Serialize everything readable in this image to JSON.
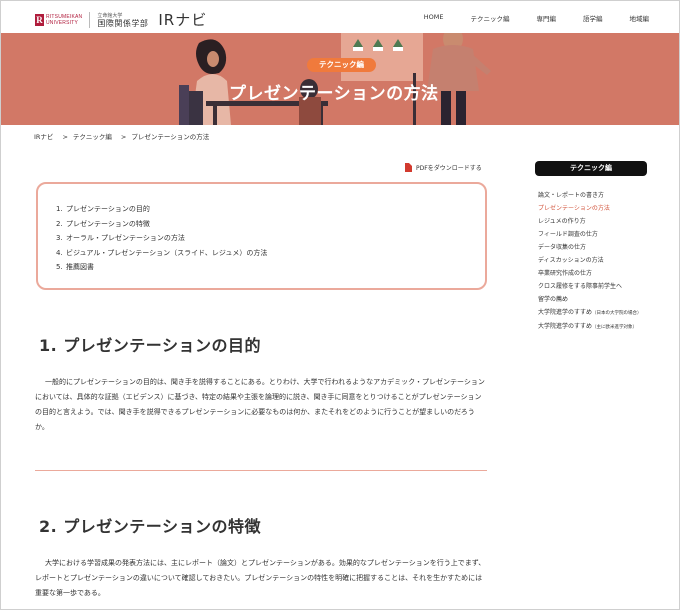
{
  "header": {
    "brand_en_line1": "RITSUMEIKAN",
    "brand_en_line2": "UNIVERSITY",
    "university": "立命館大学",
    "faculty": "国際関係学部",
    "site_name": "IRナビ",
    "nav": [
      "HOME",
      "テクニック編",
      "専門編",
      "語学編",
      "地域編"
    ]
  },
  "hero": {
    "badge": "テクニック編",
    "title": "プレゼンテーションの方法"
  },
  "breadcrumb": [
    "IRナビ",
    "テクニック編",
    "プレゼンテーションの方法"
  ],
  "pdf_link": "PDFをダウンロードする",
  "toc": [
    {
      "num": "1.",
      "label": "プレゼンテーションの目的"
    },
    {
      "num": "2.",
      "label": "プレゼンテーションの特徴"
    },
    {
      "num": "3.",
      "label": "オーラル・プレゼンテーションの方法"
    },
    {
      "num": "4.",
      "label": "ビジュアル・プレゼンテーション（スライド、レジュメ）の方法"
    },
    {
      "num": "5.",
      "label": "推薦図書"
    }
  ],
  "sections": [
    {
      "heading": "1. プレゼンテーションの目的",
      "body": "一般的にプレゼンテーションの目的は、聞き手を説得することにある。とりわけ、大学で行われるようなアカデミック・プレゼンテーションにおいては、具体的な証拠（エビデンス）に基づき、特定の結果や主張を論理的に説き、聞き手に同意をとりつけることがプレゼンテーションの目的と言えよう。では、聞き手を説得できるプレゼンテーションに必要なものは何か、またそれをどのように行うことが望ましいのだろうか。"
    },
    {
      "heading": "2. プレゼンテーションの特徴",
      "body": "大学における学習成果の発表方法には、主にレポート（論文）とプレゼンテーションがある。効果的なプレゼンテーションを行う上でまず、レポートとプレゼンテーションの違いについて確認しておきたい。プレゼンテーションの特性を明確に把握することは、それを生かすためには重要な第一歩である。"
    }
  ],
  "sidebar": {
    "heading": "テクニック編",
    "items": [
      {
        "label": "論文・レポートの書き方",
        "note": ""
      },
      {
        "label": "プレゼンテーションの方法",
        "note": ""
      },
      {
        "label": "レジュメの作り方",
        "note": ""
      },
      {
        "label": "フィールド調査の仕方",
        "note": ""
      },
      {
        "label": "データ収集の仕方",
        "note": ""
      },
      {
        "label": "ディスカッションの方法",
        "note": ""
      },
      {
        "label": "卒業研究作成の仕方",
        "note": ""
      },
      {
        "label": "クロス履修をする際事前学生へ",
        "note": ""
      },
      {
        "label": "留学の薦め",
        "note": ""
      },
      {
        "label": "大学院進学のすすめ",
        "note": "（日本の大学院の場合）"
      },
      {
        "label": "大学院進学のすすめ",
        "note": "（主に欧米進学対象）"
      }
    ],
    "active_index": 1
  },
  "colors": {
    "hero_bg": "#d27866",
    "badge_bg": "#f07a3c",
    "toc_border": "#eba99b",
    "active_link": "#d2543c",
    "brand": "#b01c3c"
  }
}
